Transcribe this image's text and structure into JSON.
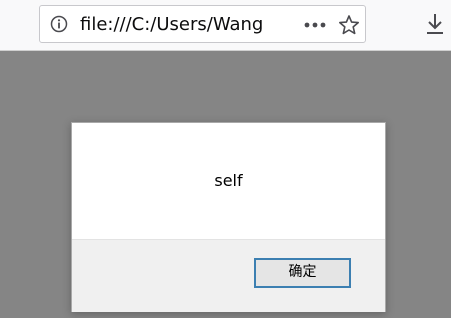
{
  "browser": {
    "url": "file:///C:/Users/Wang",
    "page_actions_icon": "more-horizontal-icon",
    "bookmark_icon": "star-icon",
    "downloads_icon": "download-icon",
    "site_info_icon": "info-icon"
  },
  "dialog": {
    "message": "self",
    "ok_label": "确定"
  },
  "colors": {
    "overlay": "#858585",
    "focus_border": "#3c7fb1"
  }
}
